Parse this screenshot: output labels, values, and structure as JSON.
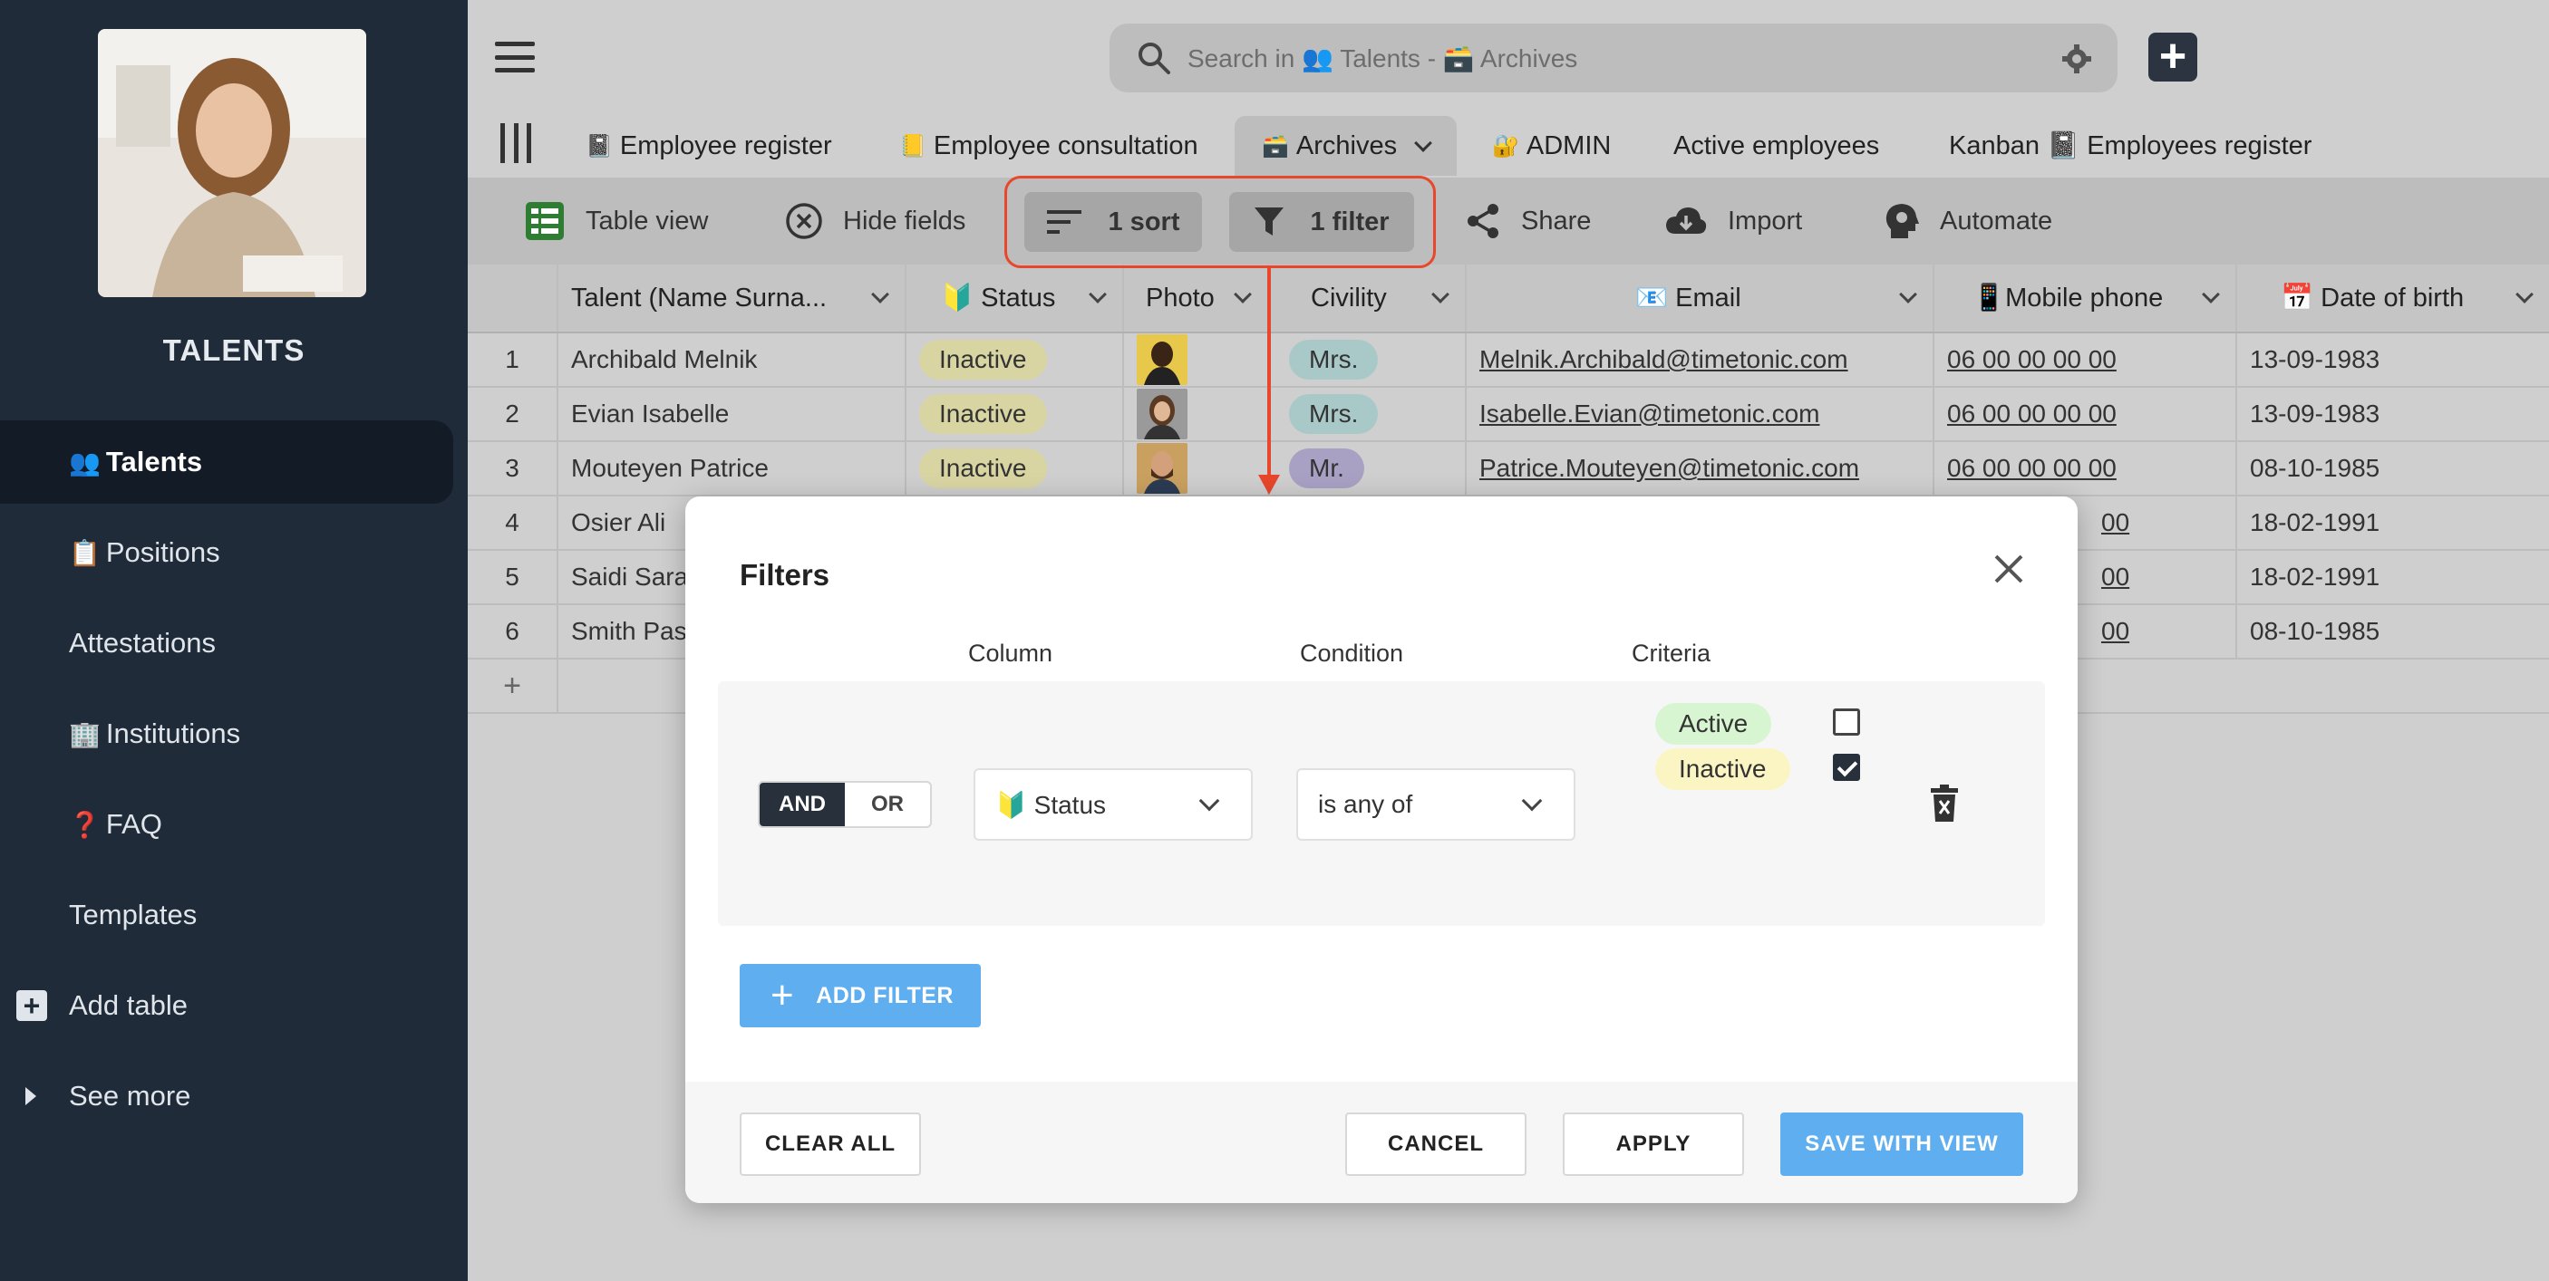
{
  "sidebar": {
    "brand": "TALENTS",
    "items": [
      {
        "emoji": "👥",
        "label": "Talents",
        "active": true
      },
      {
        "emoji": "📋",
        "label": "Positions"
      },
      {
        "emoji": "",
        "label": "Attestations"
      },
      {
        "emoji": "🏢",
        "label": "Institutions"
      },
      {
        "emoji": "❓",
        "label": "FAQ"
      },
      {
        "emoji": "",
        "label": "Templates"
      },
      {
        "emoji": "",
        "label": "Add table"
      },
      {
        "emoji": "",
        "label": "See more"
      }
    ]
  },
  "header": {
    "search_placeholder": "Search in 👥 Talents - 🗃️ Archives"
  },
  "tabs": [
    {
      "emoji": "📓",
      "label": "Employee register"
    },
    {
      "emoji": "📒",
      "label": "Employee consultation"
    },
    {
      "emoji": "🗃️",
      "label": "Archives",
      "active": true
    },
    {
      "emoji": "🔐",
      "label": "ADMIN"
    },
    {
      "emoji": "",
      "label": "Active employees"
    },
    {
      "emoji": "",
      "label": "Kanban 📓 Employees register"
    }
  ],
  "toolbar": {
    "table_view": "Table view",
    "hide_fields": "Hide fields",
    "sort": "1 sort",
    "filter": "1 filter",
    "share": "Share",
    "import": "Import",
    "automate": "Automate"
  },
  "table": {
    "columns": [
      "Talent (Name Surna...",
      "🔰 Status",
      "Photo",
      "Civility",
      "📧 Email",
      "📱Mobile phone",
      "📅 Date of birth"
    ],
    "rows": [
      {
        "num": "1",
        "name": "Archibald Melnik",
        "status": "Inactive",
        "civility": "Mrs.",
        "email": "Melnik.Archibald@timetonic.com",
        "phone": "06 00 00 00 00",
        "dob": "13-09-1983"
      },
      {
        "num": "2",
        "name": "Evian Isabelle",
        "status": "Inactive",
        "civility": "Mrs.",
        "email": "Isabelle.Evian@timetonic.com",
        "phone": "06 00 00 00 00",
        "dob": "13-09-1983"
      },
      {
        "num": "3",
        "name": "Mouteyen Patrice",
        "status": "Inactive",
        "civility": "Mr.",
        "email": "Patrice.Mouteyen@timetonic.com",
        "phone": "06 00 00 00 00",
        "dob": "08-10-1985"
      },
      {
        "num": "4",
        "name": "Osier Ali",
        "phone_tail": "00",
        "dob": "18-02-1991"
      },
      {
        "num": "5",
        "name": "Saidi Sara",
        "phone_tail": "00",
        "dob": "18-02-1991"
      },
      {
        "num": "6",
        "name": "Smith Pas",
        "phone_tail": "00",
        "dob": "08-10-1985"
      }
    ],
    "add_row": "+"
  },
  "modal": {
    "title": "Filters",
    "col_column": "Column",
    "col_condition": "Condition",
    "col_criteria": "Criteria",
    "and": "AND",
    "or": "OR",
    "column_value": "🔰 Status",
    "condition_value": "is any of",
    "criteria": [
      {
        "label": "Active",
        "checked": false,
        "color": "#d6f5d0"
      },
      {
        "label": "Inactive",
        "checked": true,
        "color": "#fbf5c4"
      }
    ],
    "add_filter": "ADD FILTER",
    "clear_all": "CLEAR ALL",
    "cancel": "CANCEL",
    "apply": "APPLY",
    "save_with_view": "SAVE WITH VIEW"
  }
}
